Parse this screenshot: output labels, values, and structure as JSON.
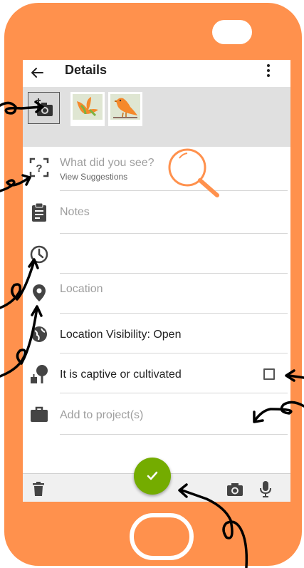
{
  "header": {
    "title": "Details"
  },
  "form": {
    "species_placeholder": "What did you see?",
    "suggestions_link": "View Suggestions",
    "notes_placeholder": "Notes",
    "location_placeholder": "Location",
    "location_visibility": "Location Visibility: Open",
    "captive_label": "It is captive or cultivated",
    "captive_checked": false,
    "projects_placeholder": "Add to project(s)"
  },
  "icons": {
    "back": "arrow-left-icon",
    "menu": "more-vertical-icon",
    "add_photo": "add-photo-camera-icon",
    "species": "identify-frame-icon",
    "notes": "clipboard-icon",
    "date": "clock-icon",
    "location": "map-pin-icon",
    "visibility": "globe-icon",
    "captive": "tree-icon",
    "projects": "briefcase-icon",
    "delete": "trash-icon",
    "camera": "camera-icon",
    "mic": "microphone-icon",
    "submit": "checkmark-icon"
  },
  "colors": {
    "phone_body": "#ff914d",
    "fab": "#74ac00",
    "annotation_ink": "#000000",
    "magnifier": "#ff914d"
  }
}
